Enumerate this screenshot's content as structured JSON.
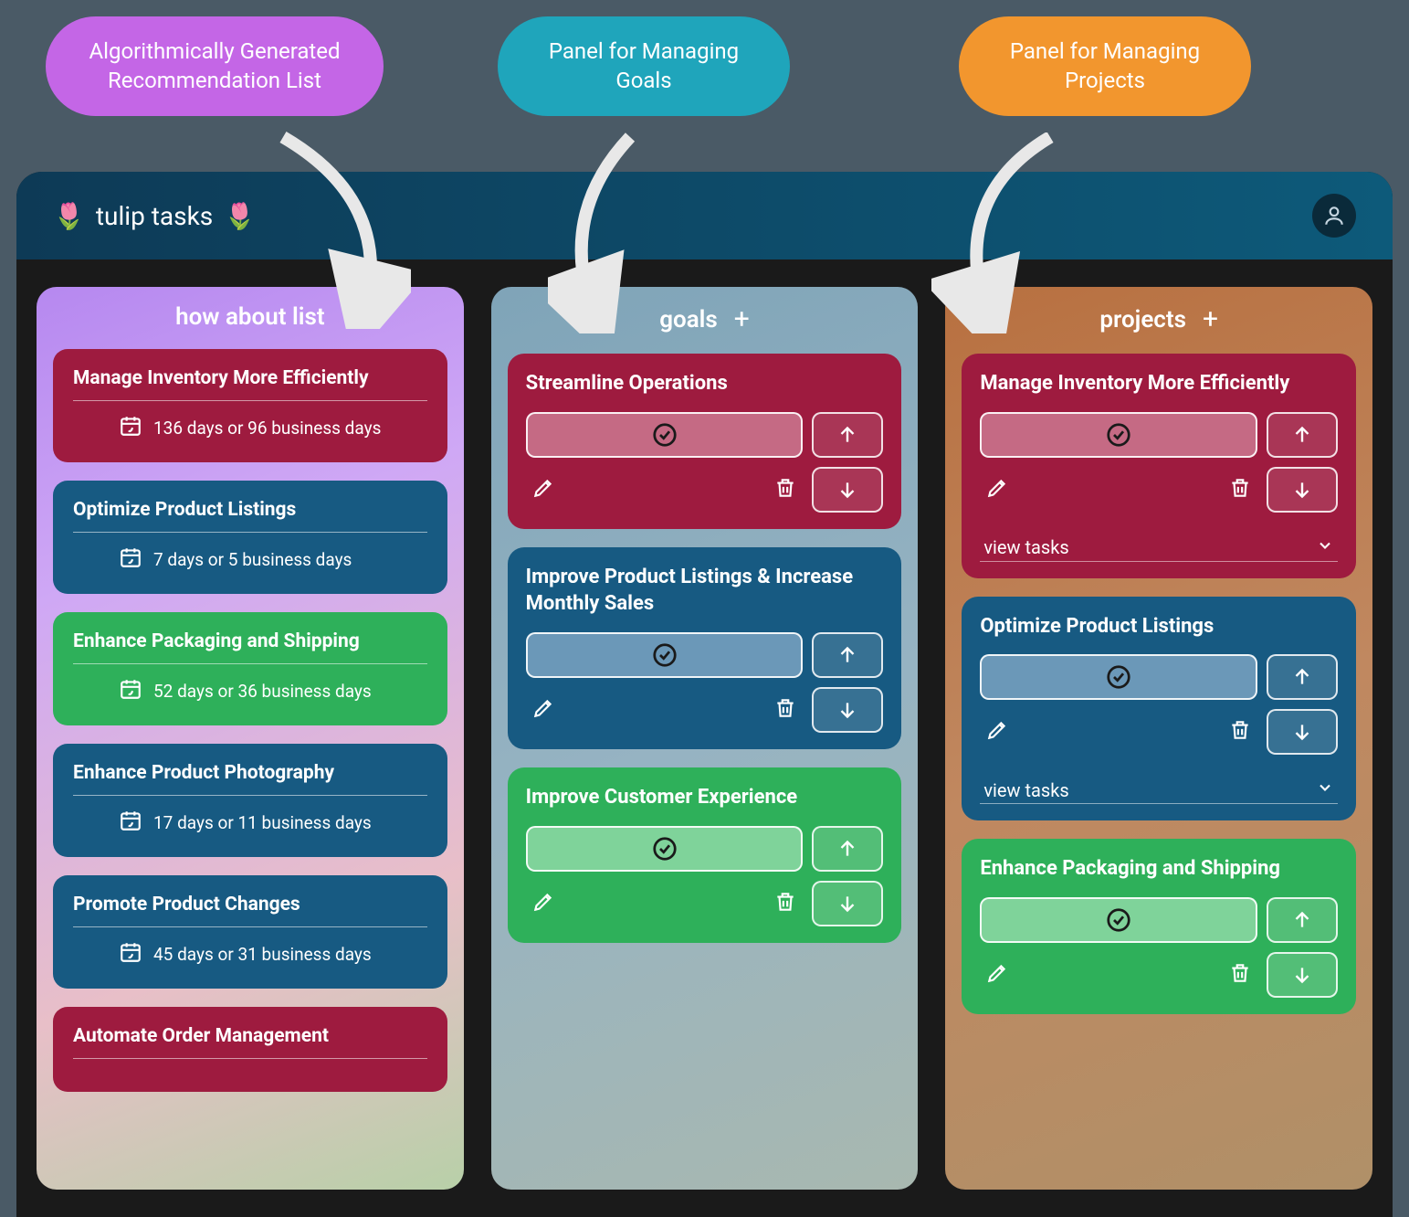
{
  "callouts": {
    "purple": "Algorithmically Generated Recommendation List",
    "teal": "Panel for Managing Goals",
    "orange": "Panel for Managing Projects"
  },
  "app": {
    "title_prefix": "🌷",
    "title": "tulip tasks",
    "title_suffix": "🌷"
  },
  "how_about": {
    "header": "how about list",
    "items": [
      {
        "title": "Manage Inventory More Efficiently",
        "meta": "136 days or 96 business days",
        "color": "crimson"
      },
      {
        "title": "Optimize Product Listings",
        "meta": "7 days or 5 business days",
        "color": "navy"
      },
      {
        "title": "Enhance Packaging and Shipping",
        "meta": "52 days or 36 business days",
        "color": "green"
      },
      {
        "title": "Enhance Product Photography",
        "meta": "17 days or 11 business days",
        "color": "navy"
      },
      {
        "title": "Promote Product Changes",
        "meta": "45 days or 31 business days",
        "color": "navy"
      },
      {
        "title": "Automate Order Management",
        "meta": "",
        "color": "crimson"
      }
    ]
  },
  "goals": {
    "header": "goals",
    "items": [
      {
        "title": "Streamline Operations",
        "color": "crimson"
      },
      {
        "title": "Improve Product Listings & Increase Monthly Sales",
        "color": "navy"
      },
      {
        "title": "Improve Customer Experience",
        "color": "green"
      }
    ]
  },
  "projects": {
    "header": "projects",
    "view_tasks_label": "view tasks",
    "items": [
      {
        "title": "Manage Inventory More Efficiently",
        "color": "crimson",
        "expandable": true
      },
      {
        "title": "Optimize Product Listings",
        "color": "navy",
        "expandable": true
      },
      {
        "title": "Enhance Packaging and Shipping",
        "color": "green",
        "expandable": false
      }
    ]
  }
}
